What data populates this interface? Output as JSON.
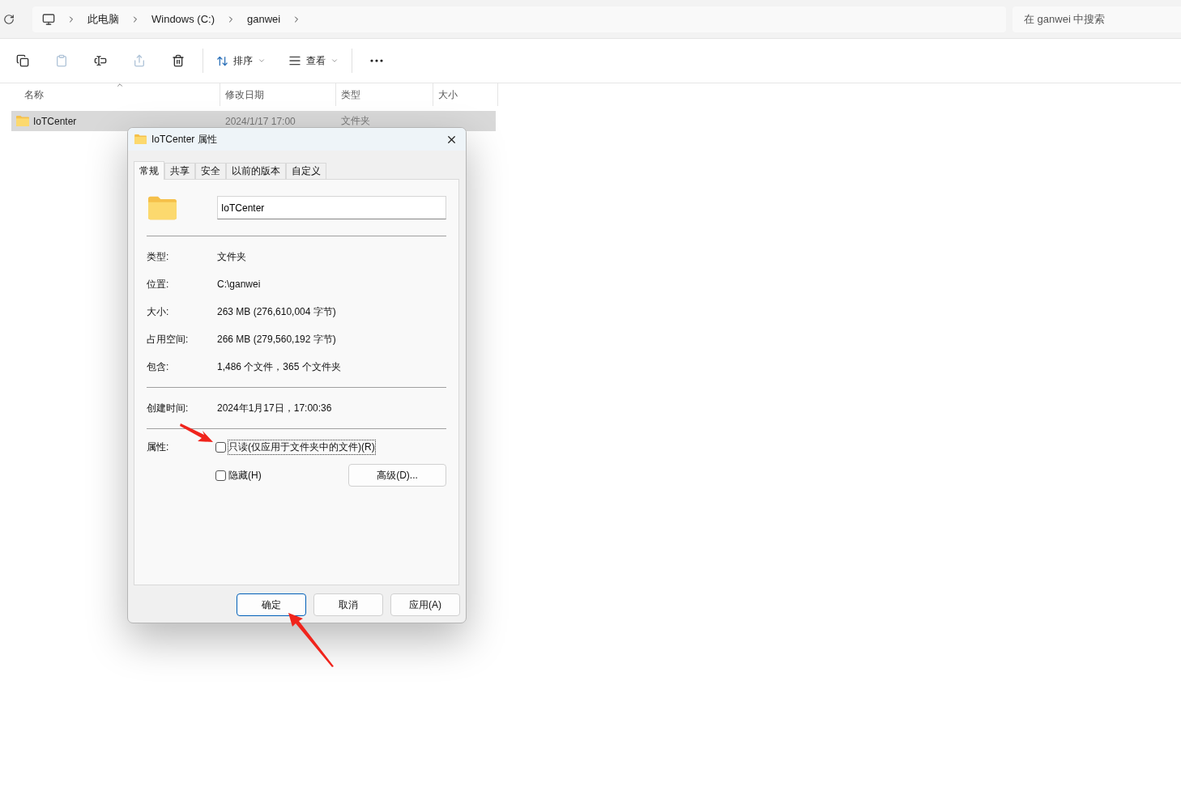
{
  "address_bar": {
    "breadcrumbs": [
      "此电脑",
      "Windows (C:)",
      "ganwei"
    ]
  },
  "search": {
    "placeholder": "在 ganwei 中搜索"
  },
  "toolbar": {
    "actions": [
      {
        "kind": "copy",
        "disabled": false
      },
      {
        "kind": "paste",
        "disabled": true
      },
      {
        "kind": "rename",
        "disabled": false
      },
      {
        "kind": "share",
        "disabled": true
      },
      {
        "kind": "delete",
        "disabled": false
      }
    ],
    "sort_label": "排序",
    "view_label": "查看"
  },
  "columns": [
    {
      "label": "名称",
      "sorted": true
    },
    {
      "label": "修改日期",
      "sorted": false
    },
    {
      "label": "类型",
      "sorted": false
    },
    {
      "label": "大小",
      "sorted": false
    }
  ],
  "rows": [
    {
      "name": "IoTCenter",
      "modified": "2024/1/17 17:00",
      "type": "文件夹",
      "selected": true
    }
  ],
  "dialog": {
    "title": "IoTCenter 属性",
    "tabs": [
      {
        "label": "常规",
        "selected": true
      },
      {
        "label": "共享",
        "selected": false
      },
      {
        "label": "安全",
        "selected": false
      },
      {
        "label": "以前的版本",
        "selected": false
      },
      {
        "label": "自定义",
        "selected": false
      }
    ],
    "name_value": "IoTCenter",
    "property_groups": [
      [
        {
          "label": "类型:",
          "value": "文件夹"
        },
        {
          "label": "位置:",
          "value": "C:\\ganwei"
        },
        {
          "label": "大小:",
          "value": "263 MB (276,610,004 字节)"
        },
        {
          "label": "占用空间:",
          "value": "266 MB (279,560,192 字节)"
        },
        {
          "label": "包含:",
          "value": "1,486 个文件，365 个文件夹"
        }
      ],
      [
        {
          "label": "创建时间:",
          "value": "2024年1月17日，17:00:36"
        }
      ]
    ],
    "attributes_label": "属性:",
    "attributes": [
      {
        "label": "只读(仅应用于文件夹中的文件)(R)",
        "checked": false,
        "focused": true
      },
      {
        "label": "隐藏(H)",
        "checked": false,
        "focused": false
      }
    ],
    "advanced_button": "高级(D)...",
    "buttons": [
      {
        "label": "确定",
        "default": true
      },
      {
        "label": "取消",
        "default": false
      },
      {
        "label": "应用(A)",
        "default": false
      }
    ]
  }
}
